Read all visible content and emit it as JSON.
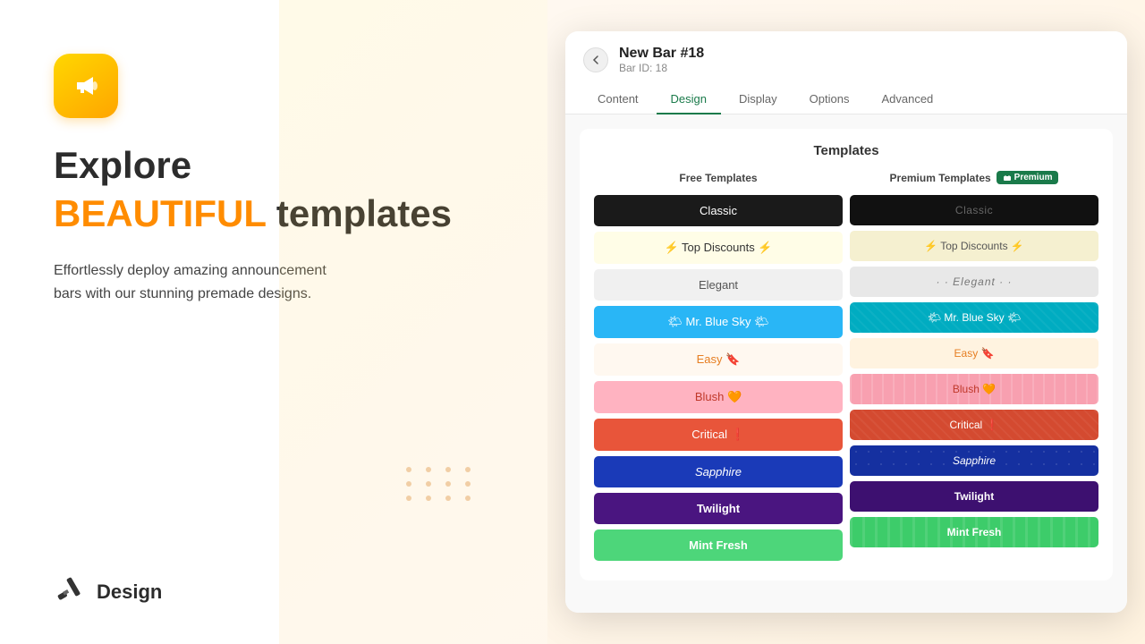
{
  "left": {
    "headline1": "Explore",
    "headline2_highlight": "BEAUTIFUL",
    "headline2_rest": " templates",
    "description": "Effortlessly deploy amazing announcement\nbars with our stunning premade designs.",
    "bottom_label": "Design"
  },
  "window": {
    "title": "New Bar #18",
    "subtitle": "Bar ID: 18",
    "tabs": [
      {
        "label": "Content",
        "active": false
      },
      {
        "label": "Design",
        "active": true
      },
      {
        "label": "Display",
        "active": false
      },
      {
        "label": "Options",
        "active": false
      },
      {
        "label": "Advanced",
        "active": false
      }
    ],
    "templates_title": "Templates",
    "free_col_header": "Free Templates",
    "premium_col_header": "Premium Templates",
    "premium_badge": "Premium",
    "templates_free": [
      {
        "name": "Classic",
        "style": "tmpl-classic-free"
      },
      {
        "name": "⚡ Top Discounts ⚡",
        "style": "tmpl-topdiscounts-free"
      },
      {
        "name": "Elegant",
        "style": "tmpl-elegant-free"
      },
      {
        "name": "🌤 Mr. Blue Sky 🌤",
        "style": "tmpl-mrbluesky-free"
      },
      {
        "name": "Easy 🔖",
        "style": "tmpl-easy-free"
      },
      {
        "name": "Blush 🧡",
        "style": "tmpl-blush-free"
      },
      {
        "name": "Critical ❗",
        "style": "tmpl-critical-free"
      },
      {
        "name": "Sapphire",
        "style": "tmpl-sapphire-free"
      },
      {
        "name": "Twilight",
        "style": "tmpl-twilight-free"
      },
      {
        "name": "Mint Fresh",
        "style": "tmpl-mintfresh-free"
      }
    ],
    "templates_premium": [
      {
        "name": "Classic",
        "style": "tmpl-classic-premium"
      },
      {
        "name": "⚡ Top Discounts ⚡",
        "style": "tmpl-topdiscounts-premium"
      },
      {
        "name": "· · Elegant · ·",
        "style": "tmpl-elegant-premium"
      },
      {
        "name": "🌤 Mr. Blue Sky 🌤",
        "style": "tmpl-mrbluesky-premium"
      },
      {
        "name": "Easy 🔖",
        "style": "tmpl-easy-premium"
      },
      {
        "name": "Blush 🧡",
        "style": "tmpl-blush-premium"
      },
      {
        "name": "Critical ❗",
        "style": "tmpl-critical-premium"
      },
      {
        "name": "Sapphire",
        "style": "tmpl-sapphire-premium"
      },
      {
        "name": "Twilight",
        "style": "tmpl-twilight-premium"
      },
      {
        "name": "Mint Fresh",
        "style": "tmpl-mintfresh-premium"
      }
    ]
  }
}
